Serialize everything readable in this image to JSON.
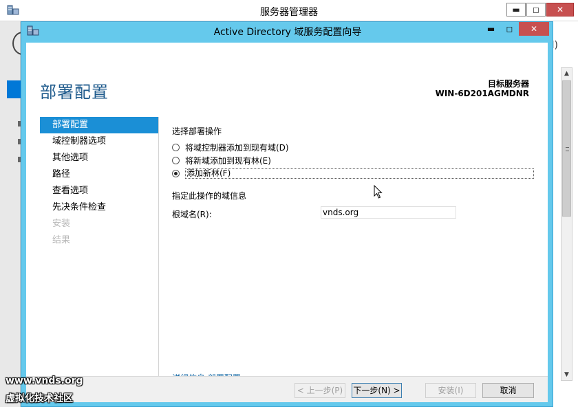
{
  "background_window": {
    "title": "服务器管理器",
    "controls": {
      "minimize": "▬",
      "maximize": "◻",
      "close": "✕"
    },
    "edge_text": "l)"
  },
  "dialog": {
    "title": "Active Directory 域服务配置向导",
    "controls": {
      "minimize": "▬",
      "maximize": "◻",
      "close": "✕"
    },
    "page_title": "部署配置",
    "target_server_label": "目标服务器",
    "target_server_name": "WIN-6D201AGMDNR",
    "nav": [
      {
        "label": "部署配置",
        "state": "active"
      },
      {
        "label": "域控制器选项",
        "state": "normal"
      },
      {
        "label": "其他选项",
        "state": "normal"
      },
      {
        "label": "路径",
        "state": "normal"
      },
      {
        "label": "查看选项",
        "state": "normal"
      },
      {
        "label": "先决条件检查",
        "state": "normal"
      },
      {
        "label": "安装",
        "state": "disabled"
      },
      {
        "label": "结果",
        "state": "disabled"
      }
    ],
    "deploy_section_label": "选择部署操作",
    "options": [
      {
        "label": "将域控制器添加到现有域(D)",
        "checked": false
      },
      {
        "label": "将新域添加到现有林(E)",
        "checked": false
      },
      {
        "label": "添加新林(F)",
        "checked": true
      }
    ],
    "domain_info_label": "指定此操作的域信息",
    "root_domain_label": "根域名(R):",
    "root_domain_value": "vnds.org",
    "details_link": "详细信息 部署配置",
    "buttons": {
      "prev": "< 上一步(P)",
      "next": "下一步(N) >",
      "install": "安装(I)",
      "cancel": "取消"
    }
  },
  "watermark": {
    "line1": "www.vnds.org",
    "line2": "虚拟化技术社区"
  },
  "colors": {
    "dialog_frame": "#65c9ec",
    "nav_active": "#1b8fd6",
    "page_title": "#1e5a8c",
    "close_button": "#c75050"
  }
}
